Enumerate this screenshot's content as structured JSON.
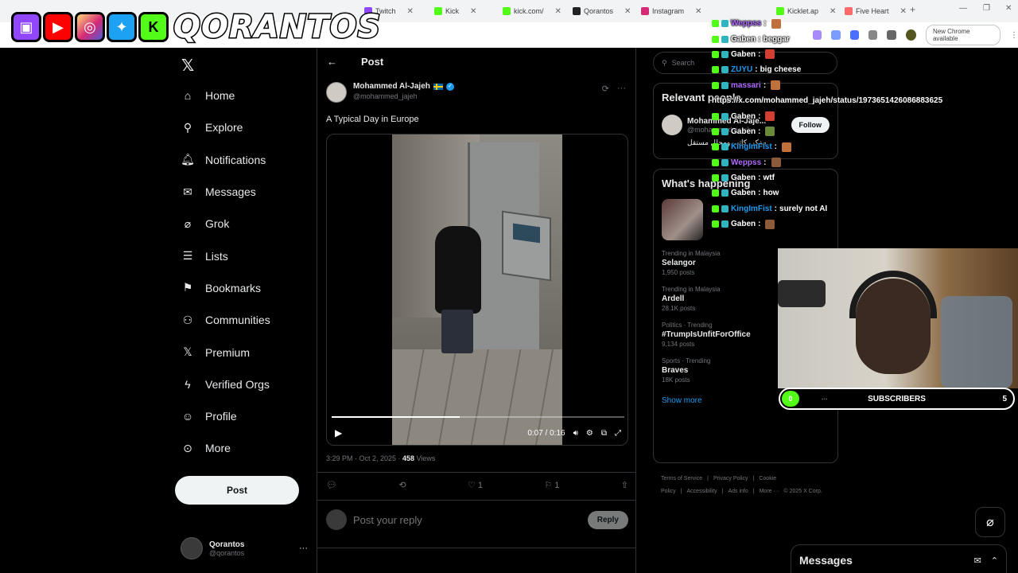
{
  "browser": {
    "tabs": [
      {
        "label": "Twitch",
        "color": "#9146ff"
      },
      {
        "label": "Kick",
        "color": "#53fc18"
      },
      {
        "label": "kick.com/",
        "color": "#53fc18"
      },
      {
        "label": "Qorantos",
        "color": "#000000"
      },
      {
        "label": "Instagram",
        "color": "#d62976"
      },
      {
        "label": "",
        "color": "#000000"
      },
      {
        "label": "Kicklet.ap",
        "color": "#53fc18"
      },
      {
        "label": "Five Heart",
        "color": "#ff6b6b"
      }
    ],
    "new_chrome_label": "New Chrome available"
  },
  "overlay": {
    "brand": "QORANTOS",
    "platform_icons": [
      "twitch-icon",
      "youtube-icon",
      "instagram-icon",
      "twitter-icon",
      "kick-icon"
    ]
  },
  "nav": {
    "items": [
      {
        "label": "Home",
        "icon": "home-icon",
        "glyph": "⌂"
      },
      {
        "label": "Explore",
        "icon": "search-icon",
        "glyph": "⚲"
      },
      {
        "label": "Notifications",
        "icon": "bell-icon",
        "glyph": "🔔︎"
      },
      {
        "label": "Messages",
        "icon": "mail-icon",
        "glyph": "✉"
      },
      {
        "label": "Grok",
        "icon": "grok-icon",
        "glyph": "⌀"
      },
      {
        "label": "Lists",
        "icon": "list-icon",
        "glyph": "☰"
      },
      {
        "label": "Bookmarks",
        "icon": "bookmark-icon",
        "glyph": "⚑"
      },
      {
        "label": "Communities",
        "icon": "people-icon",
        "glyph": "⚇"
      },
      {
        "label": "Premium",
        "icon": "x-icon",
        "glyph": "𝕏"
      },
      {
        "label": "Verified Orgs",
        "icon": "bolt-icon",
        "glyph": "ϟ"
      },
      {
        "label": "Profile",
        "icon": "person-icon",
        "glyph": "☺"
      },
      {
        "label": "More",
        "icon": "more-circle-icon",
        "glyph": "⊙"
      }
    ],
    "post_label": "Post",
    "account_name": "Qorantos",
    "account_handle": "@qorantos"
  },
  "post": {
    "header_title": "Post",
    "author_name": "Mohammed Al-Jajeh",
    "author_handle": "@mohammed_jajeh",
    "text": "A Typical Day in Europe",
    "video_time": "0:07 / 0:16",
    "video_progress": 0.4375,
    "timestamp": "3:29 PM · Oct 2, 2025 · ",
    "views_count": "458",
    "views_label": " Views",
    "likes": "1",
    "bookmarks": "1",
    "reply_placeholder": "Post your reply",
    "reply_label": "Reply"
  },
  "sidebar": {
    "search_placeholder": "Search",
    "relevant_title": "Relevant people",
    "relevant_name": "Mohammed Al-Jaje...",
    "relevant_handle": "@mohammed_jajeh",
    "follow_label": "Follow",
    "relevant_bio": "مفكر، كاتب ومحلل مستقل",
    "whats_title": "What's happening",
    "trends": [
      {
        "meta": "Trending in Malaysia",
        "name": "Selangor",
        "count": "1,950 posts"
      },
      {
        "meta": "Trending in Malaysia",
        "name": "Ardell",
        "count": "28.1K posts"
      },
      {
        "meta": "Politics · Trending",
        "name": "#TrumpIsUnfitForOffice",
        "count": "9,134 posts"
      },
      {
        "meta": "Sports · Trending",
        "name": "Braves",
        "count": "18K posts"
      }
    ],
    "show_more": "Show more",
    "footer": [
      "Terms of Service",
      "|",
      "Privacy Policy",
      "|",
      "Cookie Policy",
      "|",
      "Accessibility",
      "|",
      "Ads info",
      "|",
      "More ···",
      "© 2025 X Corp."
    ]
  },
  "chat": [
    {
      "user": "Weppss",
      "color": "#b06bff",
      "text": ""
    },
    {
      "user": "Gaben",
      "color": "#ffffff",
      "text": " beggar"
    },
    {
      "user": "Gaben",
      "color": "#ffffff",
      "text": ""
    },
    {
      "user": "ZUYU",
      "color": "#1d9bf0",
      "text": " big cheese"
    },
    {
      "user": "massari",
      "color": "#b06bff",
      "text": ""
    },
    {
      "user": "",
      "color": "#ffffff",
      "text": "https://x.com/mohammed_jajeh/status/1973651426086883625"
    },
    {
      "user": "Gaben",
      "color": "#ffffff",
      "text": ""
    },
    {
      "user": "Gaben",
      "color": "#ffffff",
      "text": ""
    },
    {
      "user": "KingImFist",
      "color": "#1d9bf0",
      "text": ""
    },
    {
      "user": "Weppss",
      "color": "#b06bff",
      "text": ""
    },
    {
      "user": "Gaben",
      "color": "#ffffff",
      "text": " wtf"
    },
    {
      "user": "Gaben",
      "color": "#ffffff",
      "text": " how"
    },
    {
      "user": "KingImFist",
      "color": "#1d9bf0",
      "text": " surely not AI"
    },
    {
      "user": "Gaben",
      "color": "#ffffff",
      "text": ""
    }
  ],
  "subgoal": {
    "current": "0",
    "label": "SUBSCRIBERS",
    "goal": "5",
    "dots": "···"
  },
  "messages_drawer": {
    "title": "Messages"
  }
}
